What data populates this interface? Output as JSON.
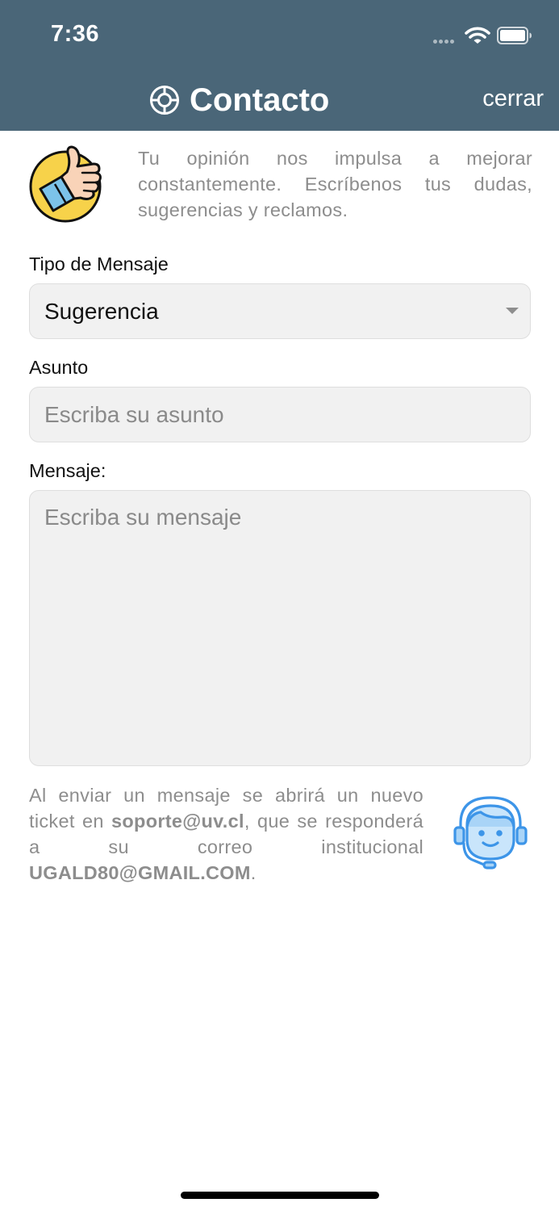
{
  "status_bar": {
    "time": "7:36",
    "icons": [
      "signal-dots-icon",
      "wifi-icon",
      "battery-icon"
    ]
  },
  "header": {
    "title": "Contacto",
    "title_icon": "lifebuoy-icon",
    "close_label": "cerrar",
    "background_color": "#4a6678"
  },
  "intro": {
    "icon": "thumbs-up-icon",
    "text": "Tu opinión nos impulsa a mejorar constantemente. Escríbenos tus dudas, sugerencias y reclamos."
  },
  "form": {
    "message_type": {
      "label": "Tipo de Mensaje",
      "selected": "Sugerencia"
    },
    "subject": {
      "label": "Asunto",
      "placeholder": "Escriba su asunto",
      "value": ""
    },
    "message": {
      "label": "Mensaje:",
      "placeholder": "Escriba su mensaje",
      "value": ""
    }
  },
  "footer": {
    "text_before_email": "Al enviar un mensaje se abrirá un nuevo ticket en ",
    "support_email": "soporte@uv.cl",
    "text_middle": ", que se responderá a su correo institucional ",
    "user_email": "UGALD80@GMAIL.COM",
    "text_end": ".",
    "icon": "support-agent-icon"
  }
}
